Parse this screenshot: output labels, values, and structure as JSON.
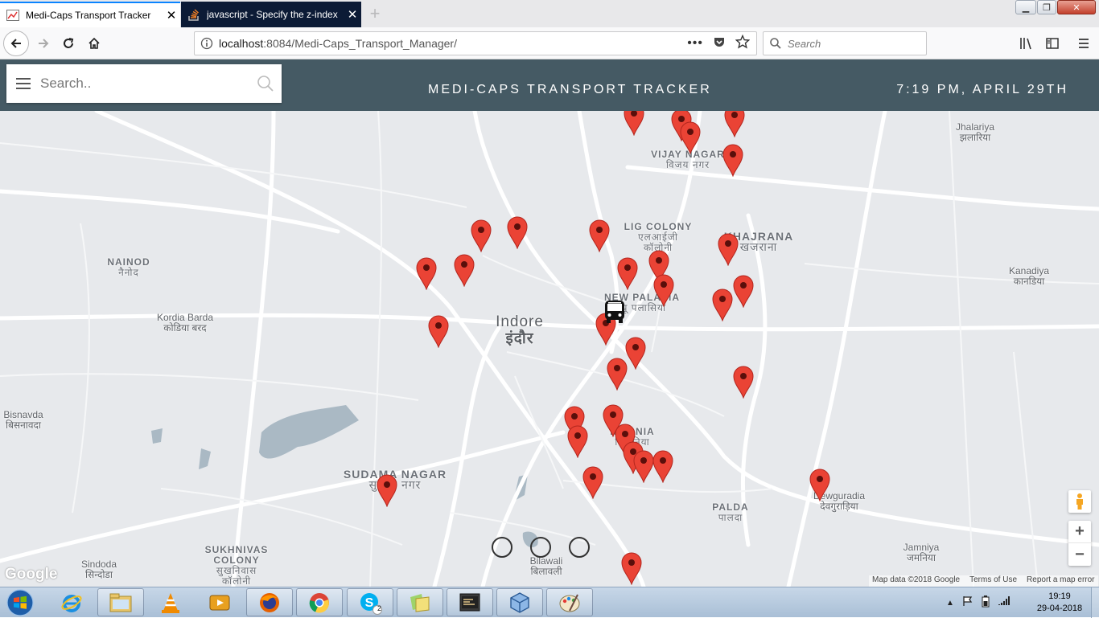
{
  "browser": {
    "tabs": [
      {
        "title": "Medi-Caps Transport Tracker",
        "active": true
      },
      {
        "title": "javascript - Specify the z-index",
        "active": false
      }
    ],
    "url_host": "localhost",
    "url_rest": ":8084/Medi-Caps_Transport_Manager/",
    "search_placeholder": "Search"
  },
  "app": {
    "search_placeholder": "Search..",
    "title": "MEDI-CAPS TRANSPORT TRACKER",
    "datetime": "7:19 PM, APRIL 29TH"
  },
  "map": {
    "city": {
      "name": "Indore",
      "name_hi": "इंदौर"
    },
    "places": [
      {
        "name": "Jhalariya",
        "name_hi": "झलारिया"
      },
      {
        "name": "VIJAY NAGAR",
        "name_hi": "विजय नगर"
      },
      {
        "name": "LIG COLONY",
        "name_hi": "एलआईजी कॉलोनी"
      },
      {
        "name": "KHAJRANA",
        "name_hi": "खजराना"
      },
      {
        "name": "NAINOD",
        "name_hi": "नैनोद"
      },
      {
        "name": "Kanadiya",
        "name_hi": "कानडिया"
      },
      {
        "name": "Kordia Barda",
        "name_hi": "कोडिया बरद"
      },
      {
        "name": "NEW PALASIA",
        "name_hi": "न्यू पलासिया"
      },
      {
        "name": "Bisnavda",
        "name_hi": "बिसनावदा"
      },
      {
        "name": "NIPANIA",
        "name_hi": "निपानिया"
      },
      {
        "name": "SUDAMA NAGAR",
        "name_hi": "सुदामा नगर"
      },
      {
        "name": "PALDA",
        "name_hi": "पालदा"
      },
      {
        "name": "Dewguradia",
        "name_hi": "देवगुराड़िया"
      },
      {
        "name": "Jamniya",
        "name_hi": "जमनिया"
      },
      {
        "name": "SUKHNIVAS COLONY",
        "name_hi": "सुखनिवास कॉलोनी"
      },
      {
        "name": "Sindoda",
        "name_hi": "सिन्दोडा"
      },
      {
        "name": "Bilawali",
        "name_hi": "बिलावली"
      }
    ],
    "google_logo": "Google",
    "attribution": [
      "Map data ©2018 Google",
      "Terms of Use",
      "Report a map error"
    ],
    "marker_color": "#ea4335",
    "header_color": "#455a64"
  },
  "taskbar": {
    "apps": [
      "internet-explorer",
      "file-explorer",
      "vlc",
      "media-player",
      "firefox",
      "chrome",
      "skype",
      "documents",
      "terminal",
      "virtualbox",
      "paint"
    ],
    "skype_badge": "2",
    "time": "19:19",
    "date": "29-04-2018"
  }
}
